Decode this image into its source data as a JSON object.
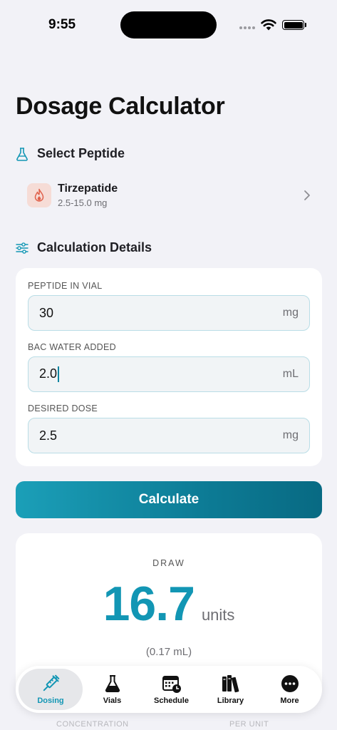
{
  "status": {
    "time": "9:55"
  },
  "page_title": "Dosage Calculator",
  "peptide_section": {
    "label": "Select Peptide",
    "selected_name": "Tirzepatide",
    "selected_range": "2.5-15.0 mg"
  },
  "details_section": {
    "label": "Calculation Details",
    "fields": [
      {
        "label": "PEPTIDE IN VIAL",
        "value": "30",
        "unit": "mg"
      },
      {
        "label": "BAC WATER ADDED",
        "value": "2.0",
        "unit": "mL"
      },
      {
        "label": "DESIRED DOSE",
        "value": "2.5",
        "unit": "mg"
      }
    ]
  },
  "calculate_label": "Calculate",
  "result": {
    "label": "DRAW",
    "value": "16.7",
    "unit": "units",
    "ml": "(0.17 mL)",
    "footer_left": "CONCENTRATION",
    "footer_right": "PER UNIT"
  },
  "tabs": [
    {
      "label": "Dosing",
      "icon": "syringe-icon",
      "active": true
    },
    {
      "label": "Vials",
      "icon": "flask-icon",
      "active": false
    },
    {
      "label": "Schedule",
      "icon": "calendar-clock-icon",
      "active": false
    },
    {
      "label": "Library",
      "icon": "books-icon",
      "active": false
    },
    {
      "label": "More",
      "icon": "more-icon",
      "active": false
    }
  ],
  "colors": {
    "accent": "#1296b4",
    "button_gradient_start": "#1b9fb8",
    "button_gradient_end": "#086a83",
    "peptide_icon_bg": "#f6dcd6",
    "peptide_icon_fg": "#e0604a"
  }
}
